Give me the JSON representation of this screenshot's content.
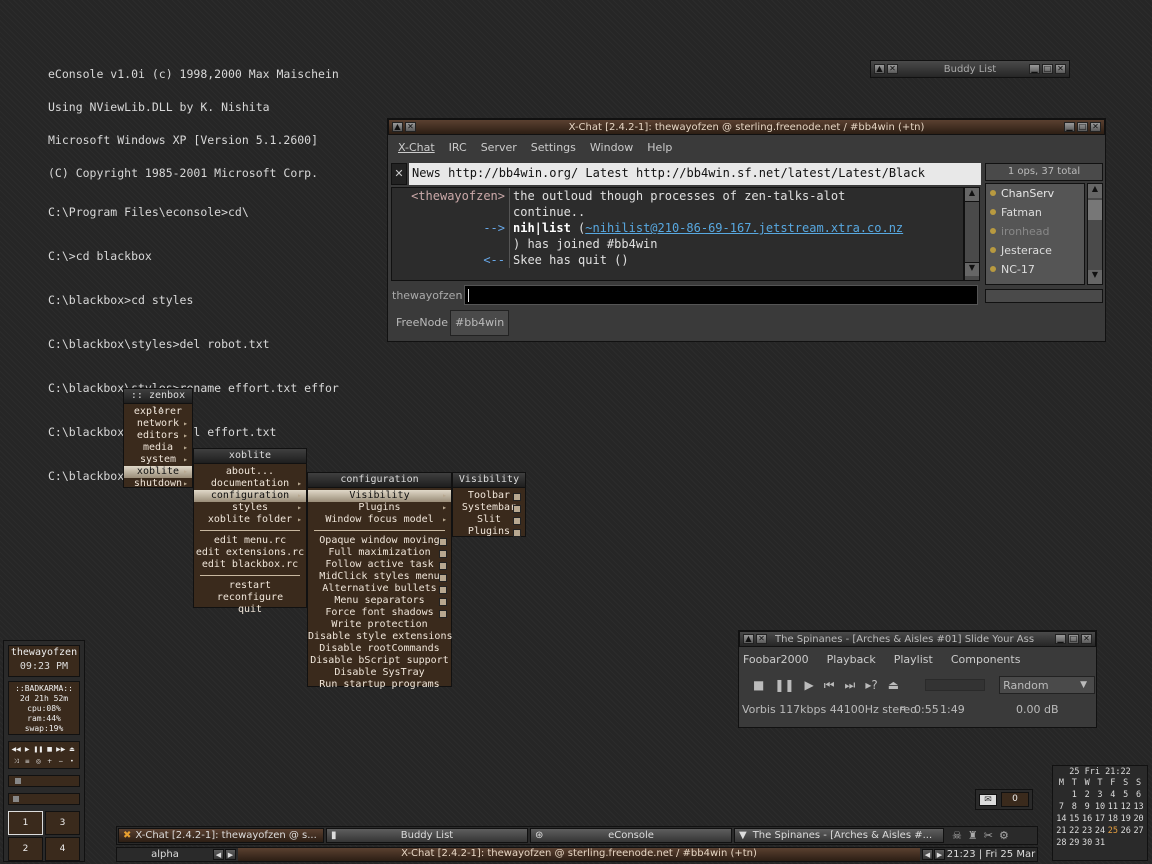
{
  "console": {
    "header": [
      "eConsole v1.0i (c) 1998,2000 Max Maischein",
      "Using NViewLib.DLL by K. Nishita",
      "Microsoft Windows XP [Version 5.1.2600]",
      "(C) Copyright 1985-2001 Microsoft Corp."
    ],
    "commands": [
      "C:\\Program Files\\econsole>cd\\",
      "C:\\>cd blackbox",
      "C:\\blackbox>cd styles",
      "C:\\blackbox\\styles>del robot.txt",
      "C:\\blackbox\\styles>rename effort.txt effor",
      "C:\\blackbox\\styles>del effort.txt",
      "C:\\blackbox\\styles>"
    ]
  },
  "buddy_list": {
    "title": "Buddy List"
  },
  "xchat": {
    "title": "X-Chat [2.4.2-1]: thewayofzen @ sterling.freenode.net / #bb4win (+tn)",
    "menu": [
      "X-Chat",
      "IRC",
      "Server",
      "Settings",
      "Window",
      "Help"
    ],
    "topic": "News http://bb4win.org/ Latest http://bb4win.sf.net/latest/Latest/Black",
    "ops_count": "1 ops, 37 total",
    "messages": [
      {
        "nick": "<thewayofzen>",
        "text1": "the outloud though processes of zen-talks-alot",
        "text2": "continue.."
      },
      {
        "nick": "-->",
        "bold": "nih|list",
        "paren": "(",
        "host": "~nihilist@210-86-69-167.jetstream.xtra.co.nz",
        "text2": ") has joined #bb4win"
      },
      {
        "nick": "<--",
        "text1": "Skee has quit ()"
      }
    ],
    "users": [
      "ChanServ",
      "Fatman",
      "ironhead",
      "Jesterace",
      "NC-17"
    ],
    "input_nick": "thewayofzen",
    "tabs": [
      "FreeNode",
      "#bb4win"
    ]
  },
  "menus": {
    "zenbox": {
      "title": ":: zenbox ::",
      "items": [
        "explorer",
        "network",
        "editors",
        "media",
        "system",
        "xoblite",
        "shutdown"
      ]
    },
    "xoblite": {
      "title": "xoblite",
      "items_a": [
        "about...",
        "documentation",
        "configuration",
        "styles",
        "xoblite folder"
      ],
      "items_b": [
        "edit menu.rc",
        "edit extensions.rc",
        "edit blackbox.rc"
      ],
      "items_c": [
        "restart",
        "reconfigure",
        "quit"
      ]
    },
    "configuration": {
      "title": "configuration",
      "items_a": [
        "Visibility",
        "Plugins",
        "Window focus model"
      ],
      "items_b": [
        "Opaque window moving",
        "Full maximization",
        "Follow active task",
        "MidClick styles menu",
        "Alternative bullets",
        "Menu separators",
        "Force font shadows",
        "Write protection",
        "Disable style extensions",
        "Disable rootCommands",
        "Disable bScript support",
        "Disable SysTray",
        "Run startup programs"
      ]
    },
    "visibility": {
      "title": "Visibility",
      "items": [
        "Toolbar",
        "Systembar",
        "Slit",
        "Plugins"
      ]
    }
  },
  "foobar": {
    "title": "The Spinanes - [Arches & Aisles #01] Slide Your Ass",
    "menu": [
      "Foobar2000",
      "Playback",
      "Playlist",
      "Components"
    ],
    "order": "Random",
    "status": {
      "codec": "Vorbis 117kbps 44100Hz stereo",
      "elapsed": "0:55",
      "total": "1:49",
      "volume": "0.00 dB"
    }
  },
  "slit": {
    "user": "thewayofzen",
    "time": "09:23 PM",
    "stats": [
      "::BADKARMA::",
      "2d 21h 52m",
      "cpu:08%",
      "ram:44%",
      "swap:19%"
    ],
    "workspaces": [
      "1",
      "3",
      "2",
      "4"
    ]
  },
  "mail": {
    "count": "0"
  },
  "calendar": {
    "header": "25 Fri 21:22",
    "days": [
      "M",
      "T",
      "W",
      "T",
      "F",
      "S",
      "S"
    ],
    "weeks": [
      [
        "",
        "",
        "1",
        "2",
        "3",
        "4",
        "5",
        "6"
      ],
      [
        "7",
        "8",
        "9",
        "10",
        "11",
        "12",
        "13"
      ],
      [
        "14",
        "15",
        "16",
        "17",
        "18",
        "19",
        "20"
      ],
      [
        "21",
        "22",
        "23",
        "24",
        "25",
        "26",
        "27"
      ],
      [
        "28",
        "29",
        "30",
        "31",
        "",
        "",
        ""
      ]
    ]
  },
  "taskbar": {
    "tasks": [
      "X-Chat [2.4.2-1]: thewayofzen @ s...",
      "Buddy List",
      "eConsole",
      "The Spinanes - [Arches & Aisles #..."
    ]
  },
  "toolbar": {
    "workspace": "alpha",
    "window_label": "X-Chat [2.4.2-1]: thewayofzen @ sterling.freenode.net / #bb4win (+tn)",
    "clock": "21:23 | Fri 25 Mar"
  }
}
